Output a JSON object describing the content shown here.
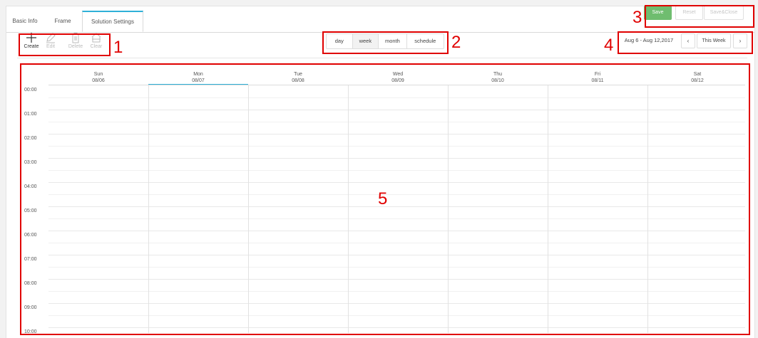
{
  "tabs": [
    "Basic Info",
    "Frame",
    "Solution Settings"
  ],
  "header_buttons": {
    "save": "Save",
    "reset": "Reset",
    "save_close": "Save&Close"
  },
  "toolbar": {
    "create": "Create",
    "edit": "Edit",
    "delete": "Delete",
    "clear": "Clear",
    "views": [
      "day",
      "week",
      "month",
      "schedule"
    ],
    "active_view": "week",
    "date_range": "Aug 6 - Aug 12,2017",
    "prev": "‹",
    "this_week": "This Week",
    "next": "›"
  },
  "calendar": {
    "days": [
      {
        "name": "Sun",
        "date": "08/06"
      },
      {
        "name": "Mon",
        "date": "08/07"
      },
      {
        "name": "Tue",
        "date": "08/08"
      },
      {
        "name": "Wed",
        "date": "08/09"
      },
      {
        "name": "Thu",
        "date": "08/10"
      },
      {
        "name": "Fri",
        "date": "08/11"
      },
      {
        "name": "Sat",
        "date": "08/12"
      }
    ],
    "today_index": 1,
    "hours": [
      "00:00",
      "01:00",
      "02:00",
      "03:00",
      "04:00",
      "05:00",
      "06:00",
      "07:00",
      "08:00",
      "09:00",
      "10:00"
    ]
  },
  "annotations": {
    "n1": "1",
    "n2": "2",
    "n3": "3",
    "n4": "4",
    "n5": "5"
  },
  "colors": {
    "annotation": "#e00000",
    "accent": "#2fb0d8",
    "save": "#6fbd6f"
  }
}
